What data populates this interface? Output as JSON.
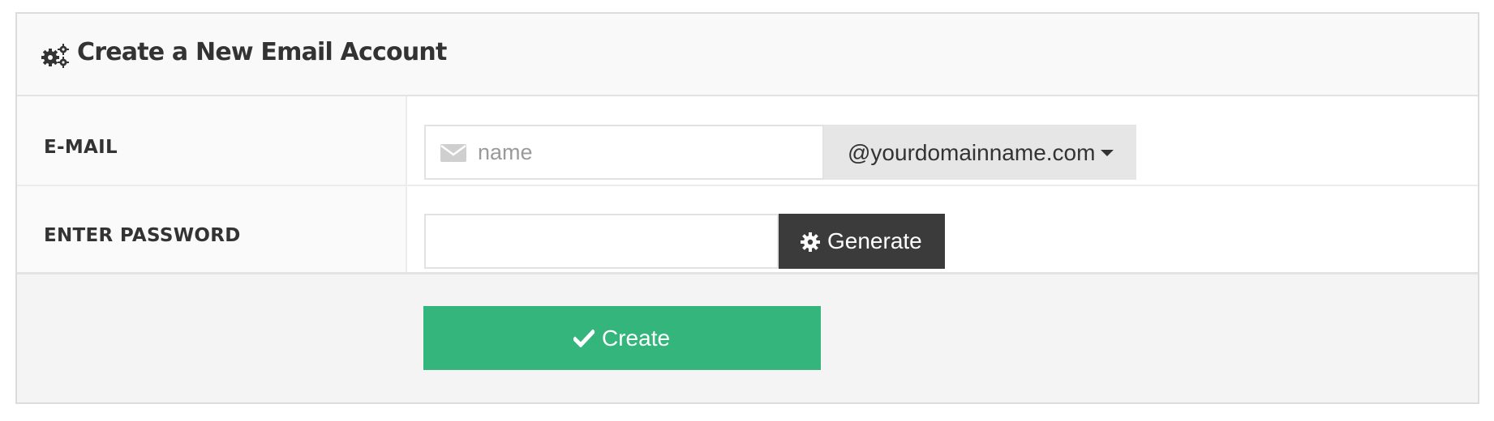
{
  "header": {
    "icon": "gears-icon",
    "title": "Create a New Email Account"
  },
  "form": {
    "email": {
      "label": "E-MAIL",
      "icon": "envelope-icon",
      "value": "",
      "placeholder": "name",
      "domain_selected": "@yourdomainname.com"
    },
    "password": {
      "label": "ENTER PASSWORD",
      "value": "",
      "generate_icon": "gear-icon",
      "generate_label": "Generate"
    }
  },
  "footer": {
    "create_icon": "check-icon",
    "create_label": "Create"
  },
  "colors": {
    "primary_green": "#33b57c",
    "dark_button": "#3b3b3b",
    "dropdown_bg": "#e6e6e6",
    "text": "#333333"
  }
}
